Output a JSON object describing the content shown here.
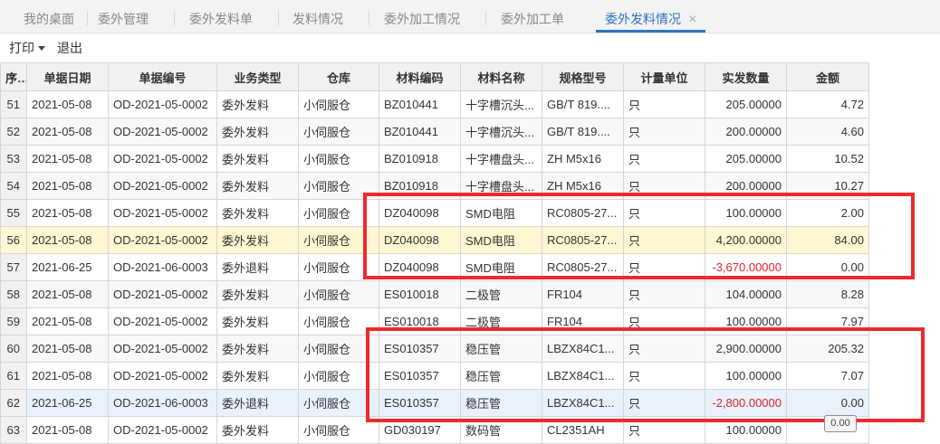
{
  "tabs": [
    {
      "label": "我的桌面",
      "active": false
    },
    {
      "label": "委外管理",
      "active": false
    },
    {
      "label": "委外发料单",
      "active": false
    },
    {
      "label": "发料情况",
      "active": false
    },
    {
      "label": "委外加工情况",
      "active": false
    },
    {
      "label": "委外加工单",
      "active": false
    },
    {
      "label": "委外发料情况",
      "active": true
    }
  ],
  "tab_close_glyph": "×",
  "toolbar": {
    "print_label": "打印",
    "exit_label": "退出"
  },
  "table": {
    "columns": [
      "序号",
      "单据日期",
      "单据编号",
      "业务类型",
      "仓库",
      "材料编码",
      "材料名称",
      "规格型号",
      "计量单位",
      "实发数量",
      "金额"
    ],
    "rows": [
      [
        "51",
        "2021-05-08",
        "OD-2021-05-0002",
        "委外发料",
        "小伺服仓",
        "BZ010441",
        "十字槽沉头...",
        "GB/T 819....",
        "只",
        "205.00000",
        "4.72"
      ],
      [
        "52",
        "2021-05-08",
        "OD-2021-05-0002",
        "委外发料",
        "小伺服仓",
        "BZ010441",
        "十字槽沉头...",
        "GB/T 819....",
        "只",
        "200.00000",
        "4.60"
      ],
      [
        "53",
        "2021-05-08",
        "OD-2021-05-0002",
        "委外发料",
        "小伺服仓",
        "BZ010918",
        "十字槽盘头...",
        "ZH M5x16",
        "只",
        "205.00000",
        "10.52"
      ],
      [
        "54",
        "2021-05-08",
        "OD-2021-05-0002",
        "委外发料",
        "小伺服仓",
        "BZ010918",
        "十字槽盘头...",
        "ZH M5x16",
        "只",
        "200.00000",
        "10.27"
      ],
      [
        "55",
        "2021-05-08",
        "OD-2021-05-0002",
        "委外发料",
        "小伺服仓",
        "DZ040098",
        "SMD电阻",
        "RC0805-27...",
        "只",
        "100.00000",
        "2.00"
      ],
      [
        "56",
        "2021-05-08",
        "OD-2021-05-0002",
        "委外发料",
        "小伺服仓",
        "DZ040098",
        "SMD电阻",
        "RC0805-27...",
        "只",
        "4,200.00000",
        "84.00"
      ],
      [
        "57",
        "2021-06-25",
        "OD-2021-06-0003",
        "委外退料",
        "小伺服仓",
        "DZ040098",
        "SMD电阻",
        "RC0805-27...",
        "只",
        "-3,670.00000",
        "0.00"
      ],
      [
        "58",
        "2021-05-08",
        "OD-2021-05-0002",
        "委外发料",
        "小伺服仓",
        "ES010018",
        "二极管",
        "FR104",
        "只",
        "104.00000",
        "8.28"
      ],
      [
        "59",
        "2021-05-08",
        "OD-2021-05-0002",
        "委外发料",
        "小伺服仓",
        "ES010018",
        "二极管",
        "FR104",
        "只",
        "100.00000",
        "7.97"
      ],
      [
        "60",
        "2021-05-08",
        "OD-2021-05-0002",
        "委外发料",
        "小伺服仓",
        "ES010357",
        "稳压管",
        "LBZX84C1...",
        "只",
        "2,900.00000",
        "205.32"
      ],
      [
        "61",
        "2021-05-08",
        "OD-2021-05-0002",
        "委外发料",
        "小伺服仓",
        "ES010357",
        "稳压管",
        "LBZX84C1...",
        "只",
        "100.00000",
        "7.07"
      ],
      [
        "62",
        "2021-06-25",
        "OD-2021-06-0003",
        "委外退料",
        "小伺服仓",
        "ES010357",
        "稳压管",
        "LBZX84C1...",
        "只",
        "-2,800.00000",
        "0.00"
      ],
      [
        "63",
        "2021-05-08",
        "OD-2021-05-0002",
        "委外发料",
        "小伺服仓",
        "GD030197",
        "数码管",
        "CL2351AH",
        "只",
        "100.00000",
        ""
      ]
    ]
  },
  "cell_tip_value": "0.00",
  "colors": {
    "active_tab": "#2b74c4",
    "negative_qty": "#e0212e",
    "annotation_box": "#ec2a2f",
    "selected_row": "#fdf7d2",
    "hover_row": "#e9f1fb"
  }
}
